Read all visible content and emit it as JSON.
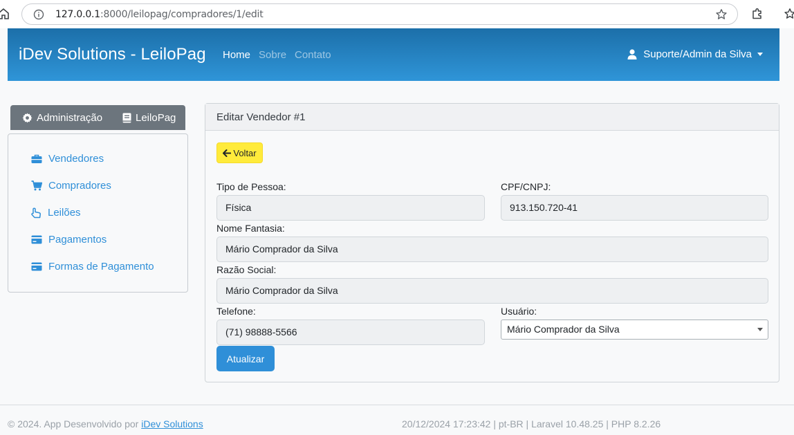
{
  "browser": {
    "url_host": "127.0.0.1",
    "url_rest": ":8000/leilopag/compradores/1/edit"
  },
  "navbar": {
    "brand": "iDev Solutions - LeiloPag",
    "links": [
      "Home",
      "Sobre",
      "Contato"
    ],
    "user": "Suporte/Admin da Silva"
  },
  "sidebar": {
    "tabs": [
      "Administração",
      "LeiloPag"
    ],
    "items": [
      "Vendedores",
      "Compradores",
      "Leilões",
      "Pagamentos",
      "Formas de Pagamento"
    ]
  },
  "card": {
    "title": "Editar Vendedor #1",
    "back_label": "Voltar",
    "fields": {
      "tipo_label": "Tipo de Pessoa:",
      "tipo_value": "Física",
      "cpf_label": "CPF/CNPJ:",
      "cpf_value": "913.150.720-41",
      "nome_label": "Nome Fantasia:",
      "nome_value": "Mário Comprador da Silva",
      "razao_label": "Razão Social:",
      "razao_value": "Mário Comprador da Silva",
      "telefone_label": "Telefone:",
      "telefone_value": "(71) 98888-5566",
      "usuario_label": "Usuário:",
      "usuario_value": "Mário Comprador da Silva"
    },
    "submit_label": "Atualizar"
  },
  "footer": {
    "copyright": "© 2024. App Desenvolvido por ",
    "link": "iDev Solutions",
    "info": "20/12/2024 17:23:42 | pt-BR | Laravel 10.48.25 | PHP 8.2.26"
  },
  "colors": {
    "primary": "#2f8fd8",
    "navbar_top": "#1c6fa9",
    "navbar_bottom": "#2f95d8",
    "back_button": "#ffeb3b",
    "sidebar_tabs": "#6c757d"
  }
}
